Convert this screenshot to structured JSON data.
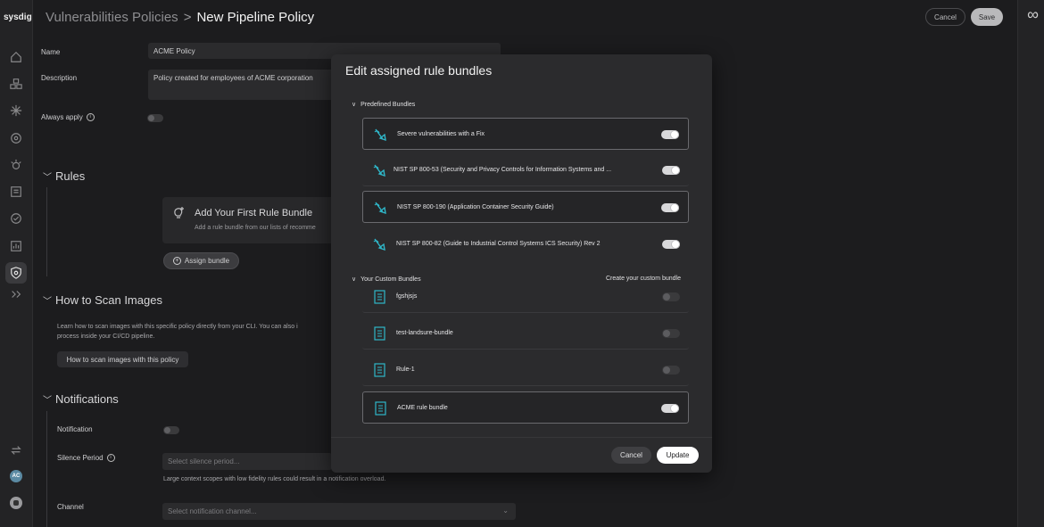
{
  "nav": {
    "logo": "sysdig",
    "avatar_initials": "AC"
  },
  "header": {
    "breadcrumb_parent": "Vulnerabilities Policies",
    "breadcrumb_separator": ">",
    "breadcrumb_current": "New Pipeline Policy",
    "cancel_label": "Cancel",
    "save_label": "Save"
  },
  "form": {
    "name_label": "Name",
    "name_value": "ACME Policy",
    "description_label": "Description",
    "description_value": "Policy created for employees of ACME corporation",
    "always_apply_label": "Always apply",
    "rules_section": "Rules",
    "empty_title": "Add Your First Rule Bundle",
    "empty_subtitle": "Add a rule bundle from our lists of recomme",
    "assign_bundle_label": "Assign bundle",
    "scan_section": "How to Scan Images",
    "scan_text_1": "Learn how to scan images with this specific policy directly from your CLI. You can also i",
    "scan_text_2": "process inside your CI/CD pipeline.",
    "scan_button": "How to scan images with this policy",
    "notifications_section": "Notifications",
    "notification_label": "Notification",
    "silence_label": "Silence Period",
    "silence_placeholder": "Select silence period...",
    "overload_note": "Large context scopes with low fidelity rules could result in a notification overload.",
    "channel_label": "Channel",
    "channel_placeholder": "Select notification channel..."
  },
  "modal": {
    "title": "Edit assigned rule bundles",
    "predefined_label": "Predefined Bundles",
    "predefined": [
      {
        "name": "Severe vulnerabilities with a Fix",
        "enabled": true
      },
      {
        "name": "NIST SP 800-53 (Security and Privacy Controls for Information Systems and ...",
        "enabled": true
      },
      {
        "name": "NIST SP 800-190 (Application Container Security Guide)",
        "enabled": true
      },
      {
        "name": "NIST SP 800-82 (Guide to Industrial Control Systems ICS Security) Rev 2",
        "enabled": true
      }
    ],
    "custom_label": "Your Custom Bundles",
    "create_custom_label": "Create your custom bundle",
    "custom": [
      {
        "name": "fgshjsjs",
        "enabled": false
      },
      {
        "name": "test-landsure-bundle",
        "enabled": false
      },
      {
        "name": "Rule-1",
        "enabled": false
      },
      {
        "name": "ACME rule bundle",
        "enabled": true
      }
    ],
    "cancel_label": "Cancel",
    "update_label": "Update"
  },
  "colors": {
    "accent_teal": "#2fb7c9",
    "toggle_on": "#d8d8da",
    "background": "#1c1c1e",
    "modal_bg": "#2b2b2d"
  }
}
